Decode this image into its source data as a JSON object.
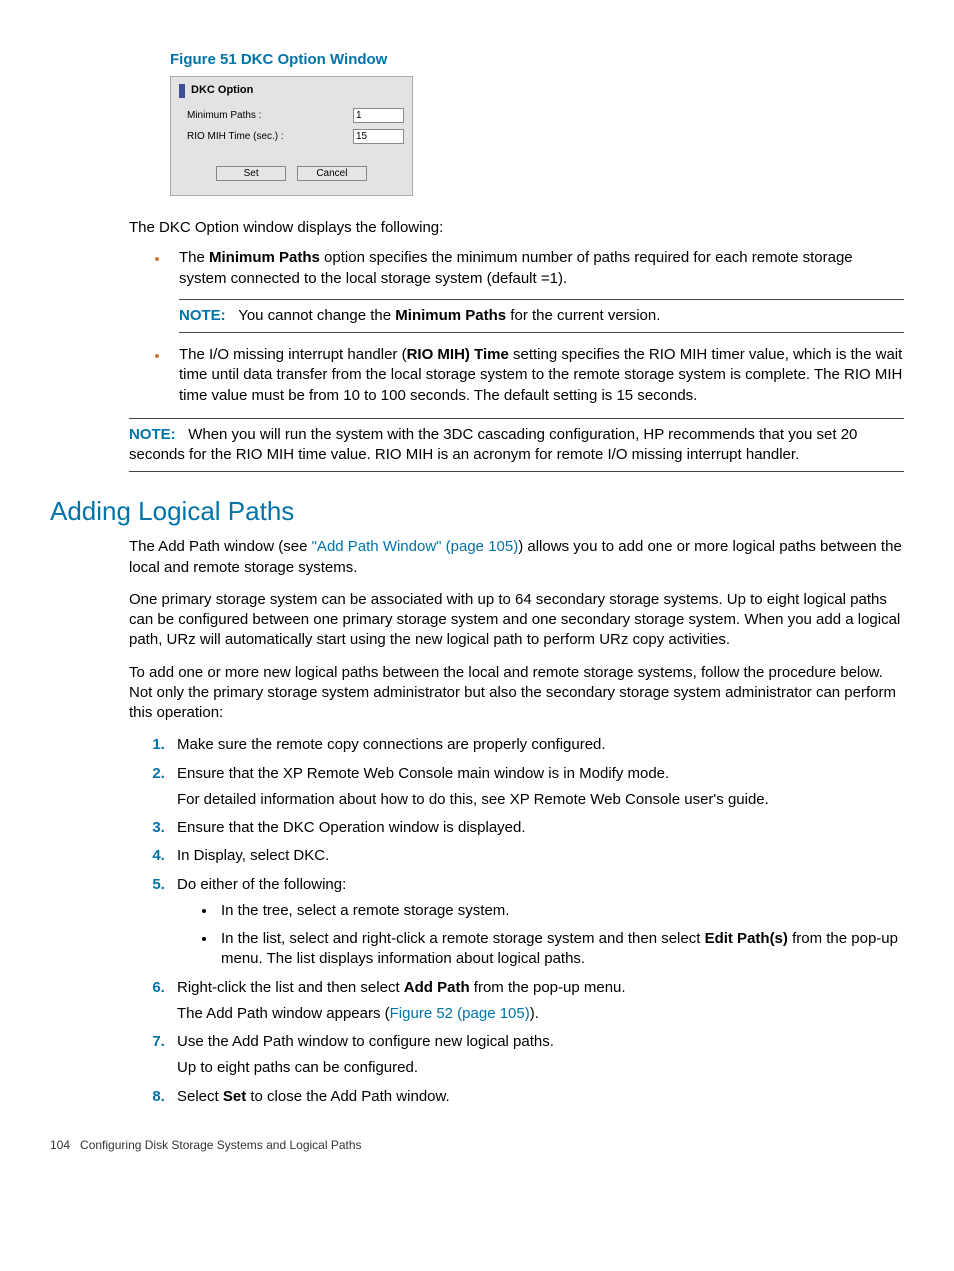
{
  "figure": {
    "caption": "Figure 51 DKC Option Window",
    "window_title": "DKC Option",
    "min_paths_label": "Minimum Paths :",
    "min_paths_value": "1",
    "rio_label": "RIO MIH Time (sec.) :",
    "rio_value": "15",
    "set": "Set",
    "cancel": "Cancel"
  },
  "intro": "The DKC Option window displays the following:",
  "bullet1": {
    "pre": "The ",
    "bold": "Minimum Paths",
    "post": " option specifies the minimum number of paths required for each remote storage system connected to the local storage system (default =1)."
  },
  "note1": {
    "label": "NOTE:",
    "pre": "You cannot change the ",
    "bold": "Minimum Paths",
    "post": " for the current version."
  },
  "bullet2": {
    "pre": "The I/O missing interrupt handler (",
    "bold": "RIO MIH) Time",
    "post": " setting specifies the RIO MIH timer value, which is the wait time until data transfer from the local storage system to the remote storage system is complete. The RIO MIH time value must be from 10 to 100 seconds. The default setting is 15 seconds."
  },
  "note2": {
    "label": "NOTE:",
    "text": "When you will run the system with the 3DC cascading configuration, HP recommends that you set 20 seconds for the RIO MIH time value. RIO MIH is an acronym for remote I/O missing interrupt handler."
  },
  "section_heading": "Adding Logical Paths",
  "p1": {
    "pre": "The Add Path window (see ",
    "link": "\"Add Path Window\" (page 105)",
    "post": ") allows you to add one or more logical paths between the local and remote storage systems."
  },
  "p2": "One primary storage system can be associated with up to 64 secondary storage systems. Up to eight logical paths can be configured between one primary storage system and one secondary storage system. When you add a logical path, URz will automatically start using the new logical path to perform URz copy activities.",
  "p3": "To add one or more new logical paths between the local and remote storage systems, follow the procedure below. Not only the primary storage system administrator but also the secondary storage system administrator can perform this operation:",
  "steps": {
    "s1": "Make sure the remote copy connections are properly configured.",
    "s2a": "Ensure that the XP Remote Web Console main window is in Modify mode.",
    "s2b": "For detailed information about how to do this, see XP Remote Web Console user's guide.",
    "s3": "Ensure that the DKC Operation window is displayed.",
    "s4": "In Display, select DKC.",
    "s5": "Do either of the following:",
    "s5_sub1": "In the tree, select a remote storage system.",
    "s5_sub2_pre": "In the list, select and right-click a remote storage system and then select ",
    "s5_sub2_bold": "Edit Path(s)",
    "s5_sub2_post": " from the pop-up menu. The list displays information about logical paths.",
    "s6a_pre": "Right-click the list and then select ",
    "s6a_bold": "Add Path",
    "s6a_post": " from the pop-up menu.",
    "s6b_pre": "The Add Path window appears (",
    "s6b_link": "Figure 52 (page 105)",
    "s6b_post": ").",
    "s7a": "Use the Add Path window to configure new logical paths.",
    "s7b": "Up to eight paths can be configured.",
    "s8_pre": "Select ",
    "s8_bold": "Set",
    "s8_post": " to close the Add Path window."
  },
  "footer": {
    "page": "104",
    "title": "Configuring Disk Storage Systems and Logical Paths"
  }
}
